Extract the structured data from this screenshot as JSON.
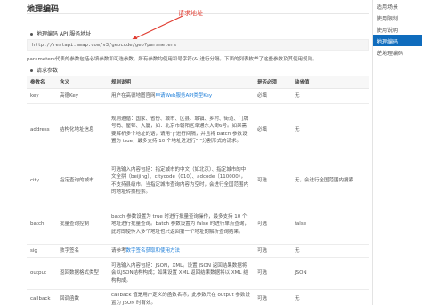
{
  "page": {
    "title": "地理编码"
  },
  "annotation": {
    "text": "请求地址",
    "color": "#e03c31"
  },
  "api_section": {
    "heading": "地理编码 API 服务地址",
    "url": "http://restapi.amap.com/v3/geocode/geo?parameters"
  },
  "description": "parameters代表的参数包括必填参数和可选参数。所有参数均使用和号字符(&)进行分隔。下面的列表枚举了这些参数及其使用规则。",
  "params_section": {
    "heading": "请求参数"
  },
  "table": {
    "headers": [
      "参数名",
      "含义",
      "规则说明",
      "是否必须",
      "缺省值"
    ],
    "rows": [
      {
        "name": "key",
        "meaning": "高德Key",
        "rule_prefix": "用户在高德地图官网",
        "rule_link": "申请Web服务API类型Key",
        "required": "必填",
        "default": "无"
      },
      {
        "name": "address",
        "meaning": "结构化地址信息",
        "rule": "规则遵循：国家、省份、城市、区县、城镇、乡村、街道、门牌号码、屋邨、大厦，如：北京市朝阳区阜通东大街6号。如果需要解析多个地址的话，请用\"|\"进行间隔，并且将 batch 参数设置为 true，最多支持 10 个地址进进行\"|\"分割形式的请求。",
        "required": "必填",
        "default": "无"
      },
      {
        "name": "city",
        "meaning": "指定查询的城市",
        "rule": "可选输入内容包括：指定城市的中文（如北京）、指定城市的中文全拼（beijing）、citycode（010）、adcode（110000），不支持县级市。当指定城市查询内容为空时，会进行全国范围内的地址转换检索。",
        "required": "可选",
        "default": "无，会进行全国范围内搜索"
      },
      {
        "name": "batch",
        "meaning": "批量查询控制",
        "rule": "batch 参数设置为 true 时进行批量查询操作，最多支持 10 个地址进行批量查询。batch 参数设置为 false 时进行单点查询，此时即使传入多个地址也只返回第一个地址的解析查询结果。",
        "required": "可选",
        "default": "false"
      },
      {
        "name": "sig",
        "meaning": "数字签名",
        "rule_prefix": "请参考",
        "rule_link": "数字签名获取和使用方法",
        "required": "可选",
        "default": "无"
      },
      {
        "name": "output",
        "meaning": "返回数据格式类型",
        "rule": "可选输入内容包括：JSON，XML。设置 JSON 返回结果数据将会以JSON结构构成；如果设置 XML 返回结果数据将以 XML 结构构成。",
        "required": "可选",
        "default": "JSON"
      },
      {
        "name": "callback",
        "meaning": "回调函数",
        "rule": "callback 值是用户定义的函数名称，此参数只在 output 参数设置为 JSON 时有效。",
        "required": "可选",
        "default": "无"
      }
    ]
  },
  "sidebar": {
    "items": [
      {
        "label": "适用场景",
        "active": false
      },
      {
        "label": "使用限制",
        "active": false
      },
      {
        "label": "使用说明",
        "active": false
      },
      {
        "label": "地理编码",
        "active": true
      },
      {
        "label": "逆地理编码",
        "active": false
      }
    ]
  }
}
